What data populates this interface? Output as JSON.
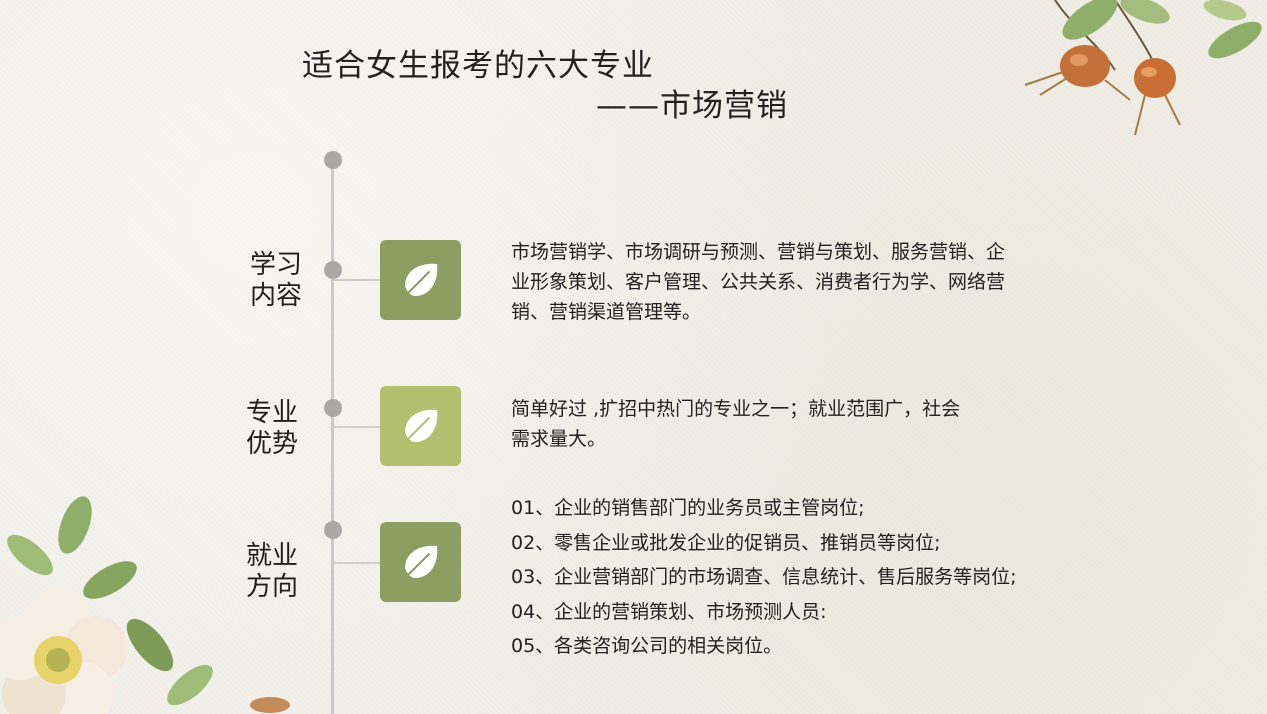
{
  "header": {
    "title_line1": "适合女生报考的六大专业",
    "title_line2": "——市场营销"
  },
  "sections": [
    {
      "label_line1": "学习",
      "label_line2": "内容",
      "badge_color": "#8e9e62",
      "icon": "leaf-icon",
      "desc_lines": [
        "市场营销学、市场调研与预测、营销与策划、服务营销、企",
        "业形象策划、客户管理、公共关系、消费者行为学、网络营",
        "销、营销渠道管理等。"
      ]
    },
    {
      "label_line1": "专业",
      "label_line2": "优势",
      "badge_color": "#b3c070",
      "icon": "leaf-icon",
      "desc_lines": [
        "简单好过 ,扩招中热门的专业之一；就业范围广，社会",
        "需求量大。"
      ]
    },
    {
      "label_line1": "就业",
      "label_line2": "方向",
      "badge_color": "#8e9e62",
      "icon": "leaf-icon",
      "items": [
        "01、企业的销售部门的业务员或主管岗位;",
        "02、零售企业或批发企业的促销员、推销员等岗位;",
        "03、企业营销部门的市场调查、信息统计、售后服务等岗位;",
        "04、企业的营销策划、市场预测人员:",
        "05、各类咨询公司的相关岗位。"
      ]
    }
  ],
  "colors": {
    "background": "#f1efe8",
    "timeline": "#c9c9c9",
    "dot": "#a9a9a9"
  }
}
